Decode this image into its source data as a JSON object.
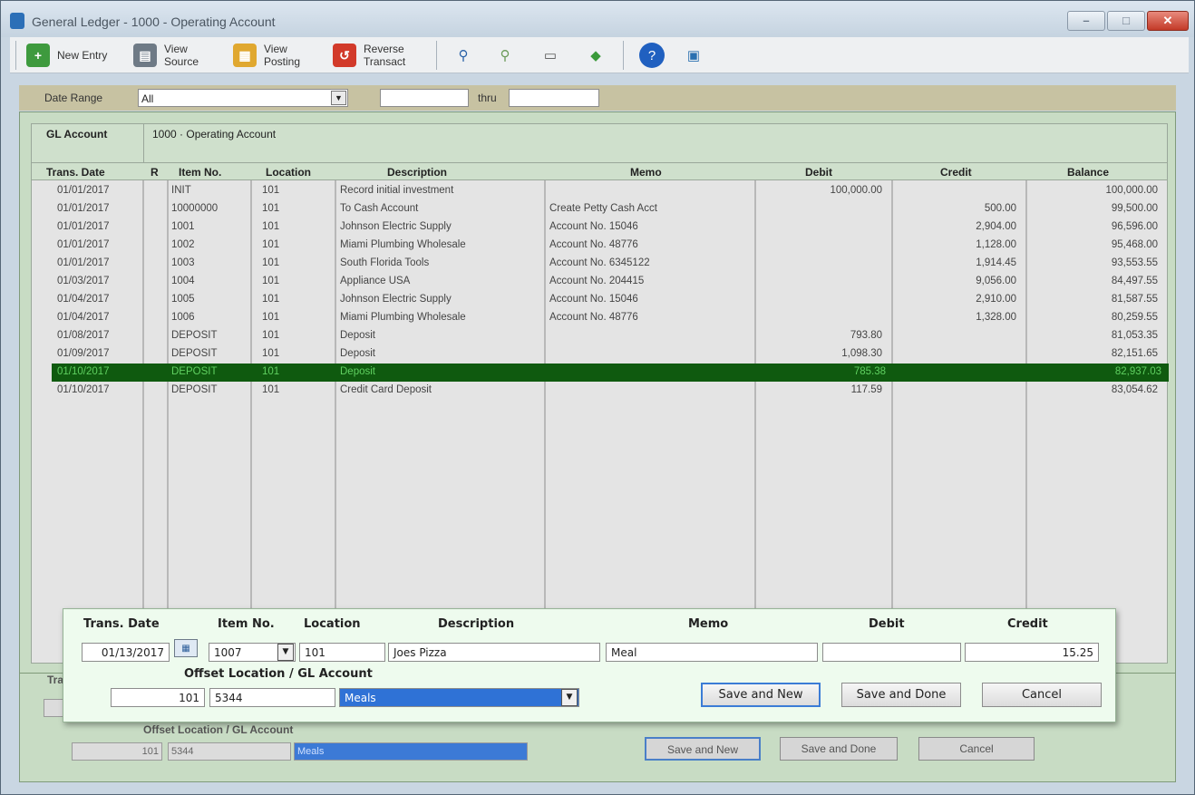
{
  "window": {
    "title": "General Ledger - 1000 - Operating Account"
  },
  "window_controls": {
    "minimize": "–",
    "maximize": "□",
    "close": "✕"
  },
  "toolbar": {
    "new_entry": "New Entry",
    "view_source": "View Source",
    "view_posting": "View Posting",
    "reverse_transact": "Reverse Transact",
    "icons": [
      "magnify-icon",
      "magnify-next-icon",
      "print-icon",
      "export-icon",
      "help-icon",
      "exit-icon"
    ]
  },
  "filter": {
    "date_range_label": "Date Range",
    "date_range_value": "All",
    "from": "",
    "thru_label": "thru",
    "to": ""
  },
  "account": {
    "label": "GL Account",
    "value": "1000 · Operating Account"
  },
  "columns": [
    "Trans. Date",
    "R",
    "Item No.",
    "Location",
    "Description",
    "Memo",
    "Debit",
    "Credit",
    "Balance"
  ],
  "rows": [
    {
      "date": "01/01/2017",
      "r": "",
      "item": "INIT",
      "location": "101",
      "description": "Record initial investment",
      "memo": "",
      "debit": "100,000.00",
      "credit": "",
      "balance": "100,000.00"
    },
    {
      "date": "01/01/2017",
      "r": "",
      "item": "10000000",
      "location": "101",
      "description": "To Cash Account",
      "memo": "Create Petty Cash Acct",
      "debit": "",
      "credit": "500.00",
      "balance": "99,500.00"
    },
    {
      "date": "01/01/2017",
      "r": "",
      "item": "1001",
      "location": "101",
      "description": "Johnson Electric Supply",
      "memo": "Account No. 15046",
      "debit": "",
      "credit": "2,904.00",
      "balance": "96,596.00"
    },
    {
      "date": "01/01/2017",
      "r": "",
      "item": "1002",
      "location": "101",
      "description": "Miami Plumbing Wholesale",
      "memo": "Account No. 48776",
      "debit": "",
      "credit": "1,128.00",
      "balance": "95,468.00"
    },
    {
      "date": "01/01/2017",
      "r": "",
      "item": "1003",
      "location": "101",
      "description": "South Florida Tools",
      "memo": "Account No. 6345122",
      "debit": "",
      "credit": "1,914.45",
      "balance": "93,553.55"
    },
    {
      "date": "01/03/2017",
      "r": "",
      "item": "1004",
      "location": "101",
      "description": "Appliance USA",
      "memo": "Account No. 204415",
      "debit": "",
      "credit": "9,056.00",
      "balance": "84,497.55"
    },
    {
      "date": "01/04/2017",
      "r": "",
      "item": "1005",
      "location": "101",
      "description": "Johnson Electric Supply",
      "memo": "Account No. 15046",
      "debit": "",
      "credit": "2,910.00",
      "balance": "81,587.55"
    },
    {
      "date": "01/04/2017",
      "r": "",
      "item": "1006",
      "location": "101",
      "description": "Miami Plumbing Wholesale",
      "memo": "Account No. 48776",
      "debit": "",
      "credit": "1,328.00",
      "balance": "80,259.55"
    },
    {
      "date": "01/08/2017",
      "r": "",
      "item": "DEPOSIT",
      "location": "101",
      "description": "Deposit",
      "memo": "",
      "debit": "793.80",
      "credit": "",
      "balance": "81,053.35"
    },
    {
      "date": "01/09/2017",
      "r": "",
      "item": "DEPOSIT",
      "location": "101",
      "description": "Deposit",
      "memo": "",
      "debit": "1,098.30",
      "credit": "",
      "balance": "82,151.65"
    },
    {
      "date": "01/10/2017",
      "r": "",
      "item": "DEPOSIT",
      "location": "101",
      "description": "Deposit",
      "memo": "",
      "debit": "785.38",
      "credit": "",
      "balance": "82,937.03",
      "selected": true
    },
    {
      "date": "01/10/2017",
      "r": "",
      "item": "DEPOSIT",
      "location": "101",
      "description": "Credit Card Deposit",
      "memo": "",
      "debit": "117.59",
      "credit": "",
      "balance": "83,054.62"
    }
  ],
  "ghost_form": {
    "trans_label": "Tra",
    "offset_label": "Offset Location / GL Account",
    "location": "101",
    "gl_account": "5344",
    "account_name": "Meals",
    "save_new": "Save and New",
    "save_done": "Save and Done",
    "cancel": "Cancel"
  },
  "entry_form": {
    "labels": {
      "trans_date": "Trans. Date",
      "item_no": "Item No.",
      "location": "Location",
      "description": "Description",
      "memo": "Memo",
      "debit": "Debit",
      "credit": "Credit",
      "offset": "Offset Location / GL Account"
    },
    "values": {
      "trans_date": "01/13/2017",
      "item_no": "1007",
      "location": "101",
      "description": "Joes Pizza",
      "memo": "Meal",
      "debit": "",
      "credit": "15.25",
      "offset_location": "101",
      "offset_account": "5344",
      "offset_account_name": "Meals"
    },
    "buttons": {
      "save_new": "Save and New",
      "save_done": "Save and Done",
      "cancel": "Cancel"
    }
  }
}
